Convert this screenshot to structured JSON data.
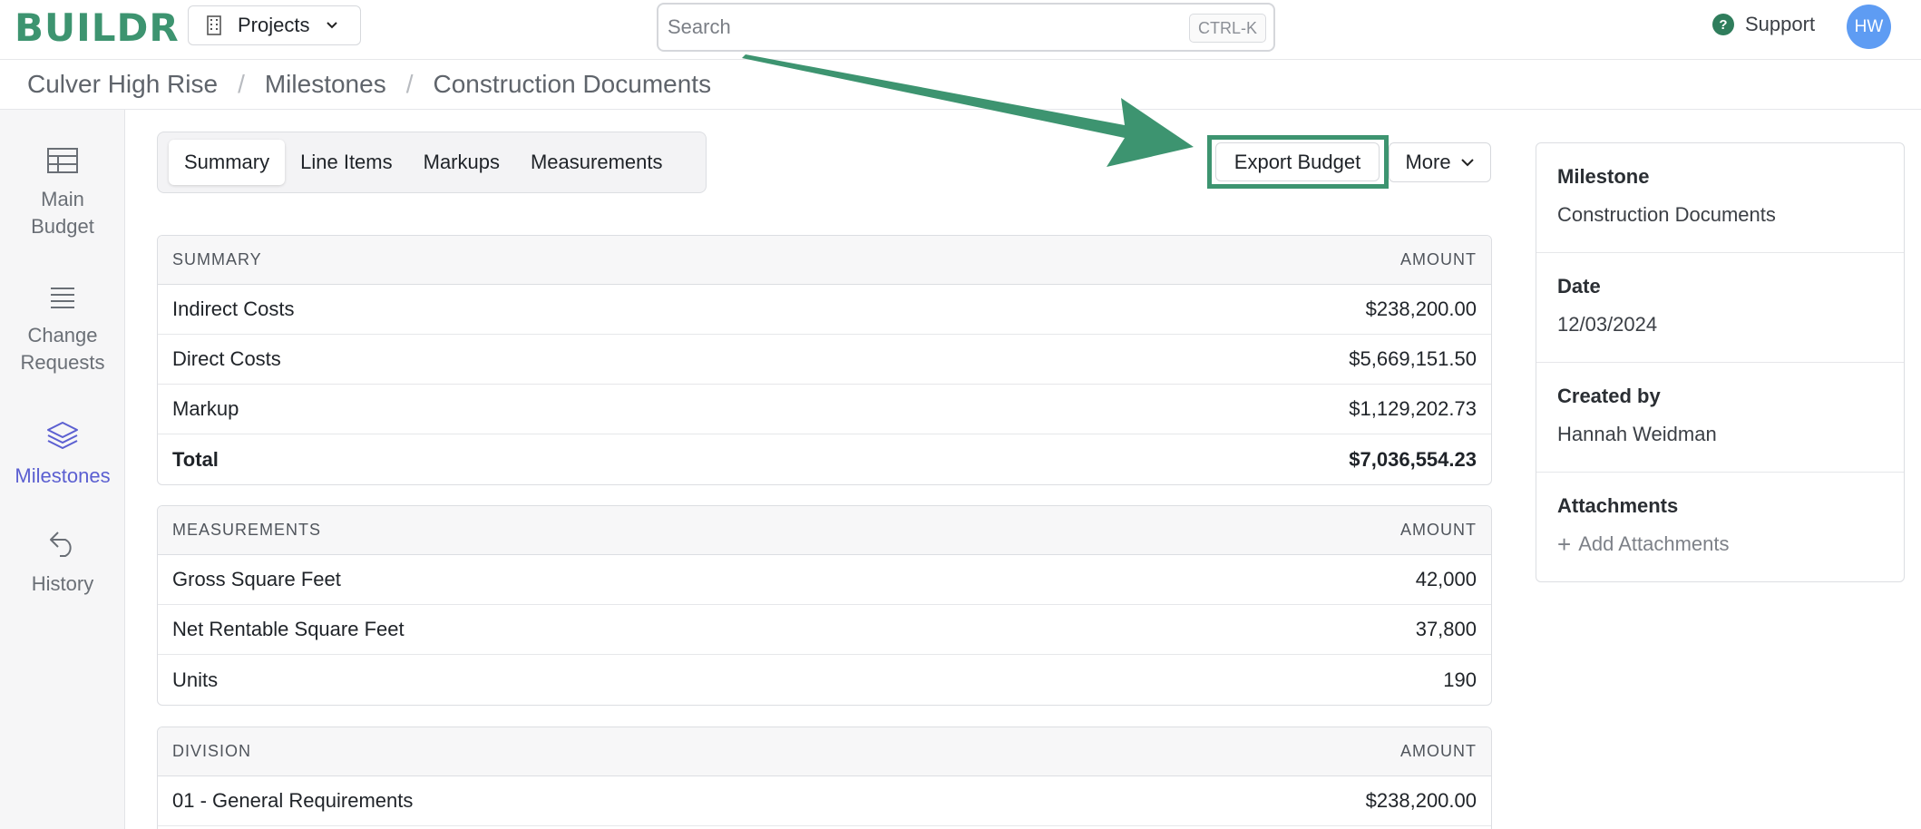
{
  "header": {
    "logo": "BUILDR",
    "projects_label": "Projects",
    "search_placeholder": "Search",
    "search_shortcut": "CTRL-K",
    "support_label": "Support",
    "avatar_initials": "HW"
  },
  "breadcrumb": [
    "Culver High Rise",
    "Milestones",
    "Construction Documents"
  ],
  "sidebar": {
    "items": [
      {
        "label_1": "Main",
        "label_2": "Budget",
        "icon": "table-icon"
      },
      {
        "label_1": "Change",
        "label_2": "Requests",
        "icon": "list-icon"
      },
      {
        "label_1": "Milestones",
        "icon": "layers-icon",
        "active": true
      },
      {
        "label_1": "History",
        "icon": "undo-icon"
      }
    ]
  },
  "tabs": [
    "Summary",
    "Line Items",
    "Markups",
    "Measurements"
  ],
  "actions": {
    "export_label": "Export Budget",
    "more_label": "More"
  },
  "summary_table": {
    "header": [
      "SUMMARY",
      "AMOUNT"
    ],
    "rows": [
      [
        "Indirect Costs",
        "$238,200.00"
      ],
      [
        "Direct Costs",
        "$5,669,151.50"
      ],
      [
        "Markup",
        "$1,129,202.73"
      ],
      [
        "Total",
        "$7,036,554.23"
      ]
    ]
  },
  "measurements_table": {
    "header": [
      "MEASUREMENTS",
      "AMOUNT"
    ],
    "rows": [
      [
        "Gross Square Feet",
        "42,000"
      ],
      [
        "Net Rentable Square Feet",
        "37,800"
      ],
      [
        "Units",
        "190"
      ]
    ]
  },
  "division_table": {
    "header": [
      "DIVISION",
      "AMOUNT"
    ],
    "rows": [
      [
        "01 - General Requirements",
        "$238,200.00"
      ]
    ]
  },
  "details": {
    "milestone_label": "Milestone",
    "milestone_value": "Construction Documents",
    "date_label": "Date",
    "date_value": "12/03/2024",
    "created_label": "Created by",
    "created_value": "Hannah Weidman",
    "attachments_label": "Attachments",
    "add_attachments": "Add Attachments"
  },
  "colors": {
    "brand": "#3d9470",
    "active_nav": "#5b5fd1",
    "avatar": "#5e9cf3"
  }
}
